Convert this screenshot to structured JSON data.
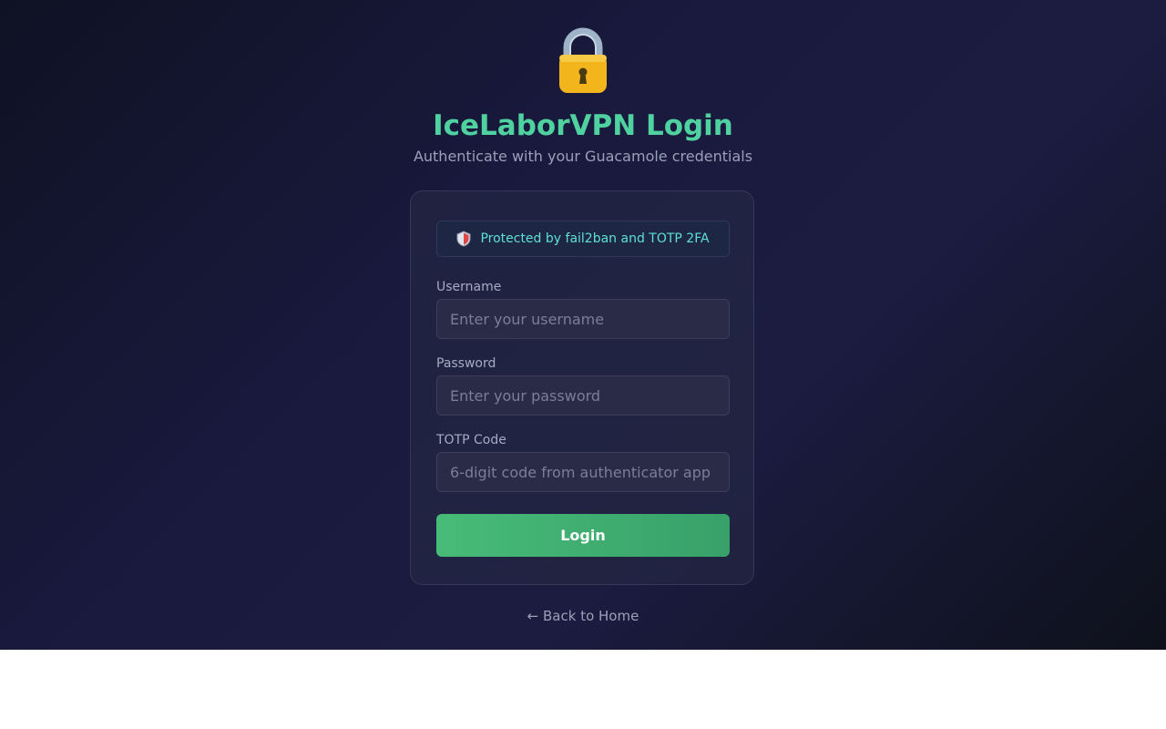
{
  "header": {
    "lock_icon": "lock-icon",
    "title": "IceLaborVPN Login",
    "subtitle": "Authenticate with your Guacamole credentials"
  },
  "card": {
    "notice": {
      "icon": "shield-icon",
      "text": "Protected by fail2ban and TOTP 2FA"
    },
    "username": {
      "label": "Username",
      "placeholder": "Enter your username",
      "value": ""
    },
    "password": {
      "label": "Password",
      "placeholder": "Enter your password",
      "value": ""
    },
    "totp": {
      "label": "TOTP Code",
      "placeholder": "6-digit code from authenticator app",
      "value": ""
    },
    "login_label": "Login"
  },
  "footer": {
    "back_link": "← Back to Home"
  },
  "colors": {
    "accent": "#4fd1a0",
    "button": "#48bb78",
    "notice_text": "#5fe0d6",
    "background": "#191a3e"
  }
}
